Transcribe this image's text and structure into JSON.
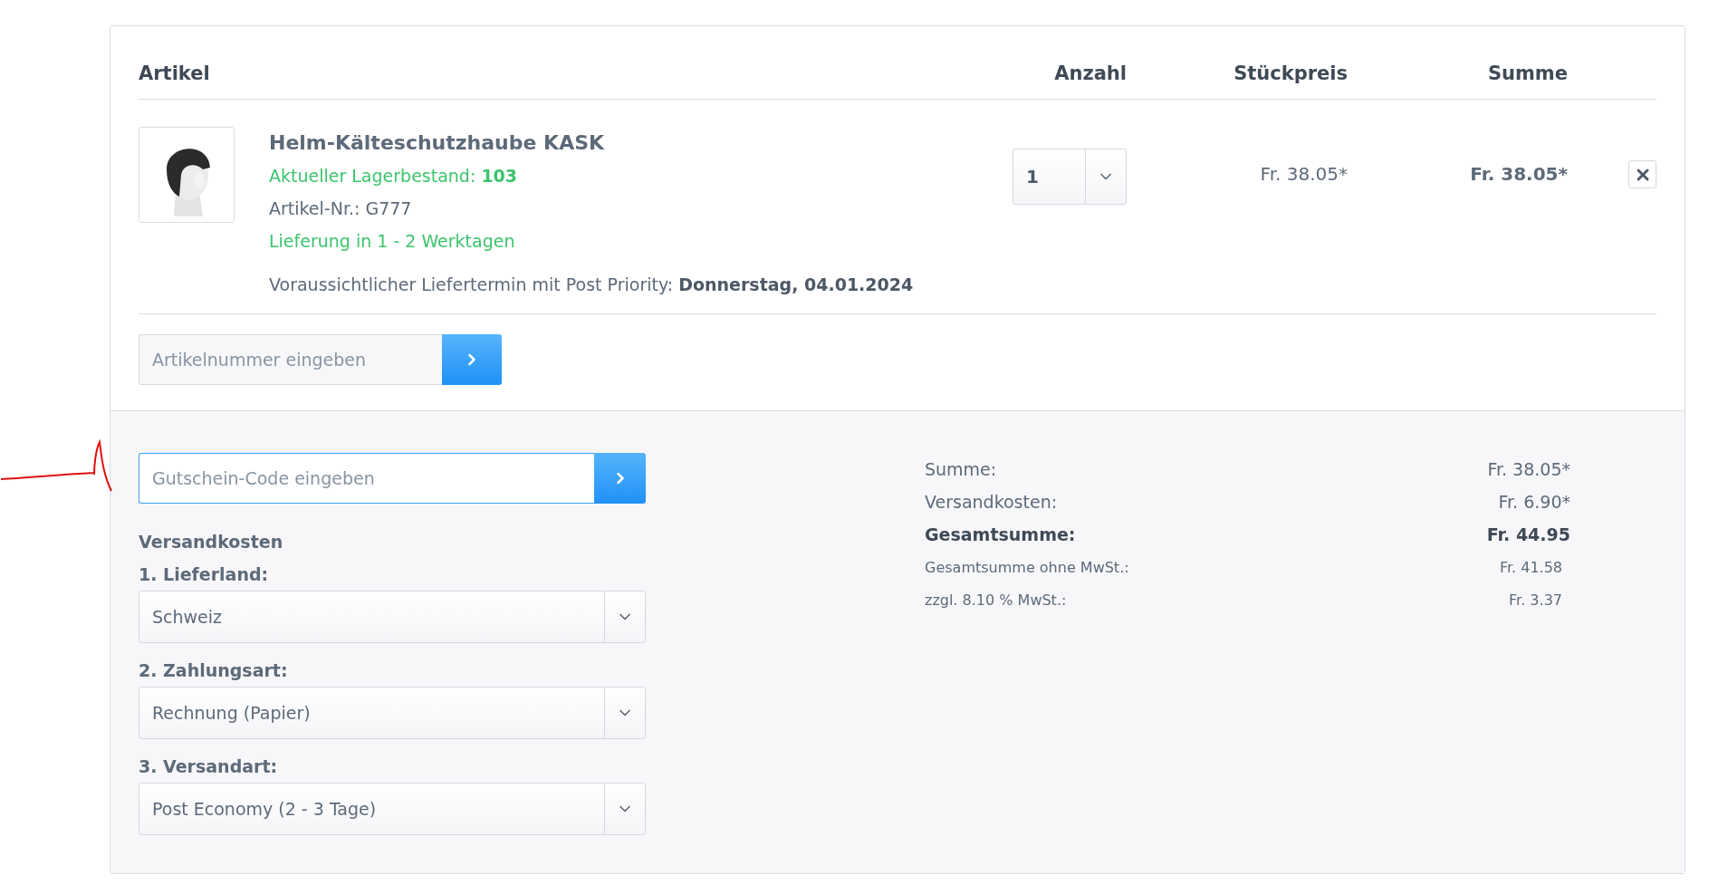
{
  "table": {
    "columns": [
      {
        "label": "Artikel"
      },
      {
        "label": "Anzahl"
      },
      {
        "label": "Stückpreis"
      },
      {
        "label": "Summe"
      }
    ]
  },
  "items": [
    {
      "name": "Helm-Kälteschutzhaube KASK",
      "stock_label": "Aktueller Lagerbestand:",
      "stock": "103",
      "article_no": "Artikel-Nr.: G777",
      "delivery": "Lieferung in 1 - 2 Werktagen",
      "delivery_date": "Voraussichtlicher Liefertermin mit Post Priority: **Donnerstag, 04.01.2024**",
      "quantity": "1",
      "unit_price": "Fr. 38.05*",
      "total": "Fr. 38.05*"
    }
  ],
  "article_input": {
    "placeholder": "Artikelnummer eingeben"
  },
  "voucher_input": {
    "placeholder": "Gutschein-Code eingeben",
    "focused": true
  },
  "shipping": {
    "title": "Versandkosten",
    "fields": [
      {
        "label": "1. Lieferland:",
        "value": "Schweiz"
      },
      {
        "label": "2. Zahlungsart:",
        "value": "Rechnung (Papier)"
      },
      {
        "label": "3. Versandart:",
        "value": "Post Economy (2 - 3 Tage)"
      }
    ]
  },
  "summary": [
    {
      "kind": "normal",
      "label": "Summe:",
      "value": "Fr. 38.05*"
    },
    {
      "kind": "normal",
      "label": "Versandkosten:",
      "value": "Fr. 6.90*"
    },
    {
      "kind": "total",
      "label": "Gesamtsumme:",
      "value": "Fr. 44.95"
    },
    {
      "kind": "small",
      "label": "Gesamtsumme ohne MwSt.:",
      "value": "Fr. 41.58"
    },
    {
      "kind": "small",
      "label": "zzgl. 8.10 % MwSt.:",
      "value": "Fr. 3.37"
    }
  ]
}
